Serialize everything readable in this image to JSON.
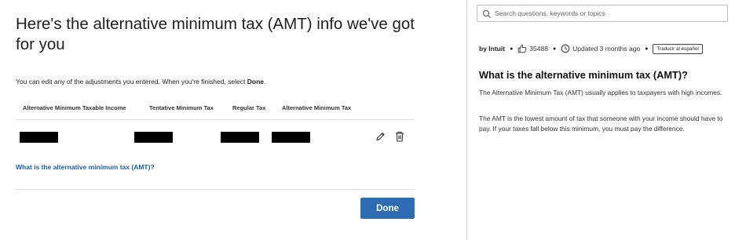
{
  "main": {
    "title": "Here's the alternative minimum tax (AMT) info we've got for you",
    "intro_prefix": "You can edit any of the adjustments you entered. When you're finished, select ",
    "intro_bold": "Done",
    "intro_suffix": ".",
    "table": {
      "columns": [
        "Alternative Minimum Taxable Income",
        "Tentative Minimum Tax",
        "Regular Tax",
        "Alternative Minimum Tax"
      ]
    },
    "help_link": "What is the alternative minimum tax (AMT)?",
    "done_label": "Done"
  },
  "sidebar": {
    "search_placeholder": "Search questions, keywords or topics",
    "byline": "by Intuit",
    "likes": "35488",
    "updated": "Updated 3 months ago",
    "translate_label": "Traducir al español",
    "article_title": "What is the alternative minimum tax (AMT)?",
    "paragraphs": [
      "The Alternative Minimum Tax (AMT) usually applies to taxpayers with high incomes.",
      "The AMT is the lowest amount of tax that someone with your income should have to pay. If your taxes fall below this minimum, you must pay the difference."
    ]
  },
  "colors": {
    "primary_button": "#2e6db4",
    "link": "#1e5fa8",
    "redaction": "#000000"
  },
  "icons": {
    "edit": "pencil-icon",
    "delete": "trash-icon",
    "search": "search-icon",
    "like": "thumbs-up-icon",
    "updated": "clock-icon"
  }
}
